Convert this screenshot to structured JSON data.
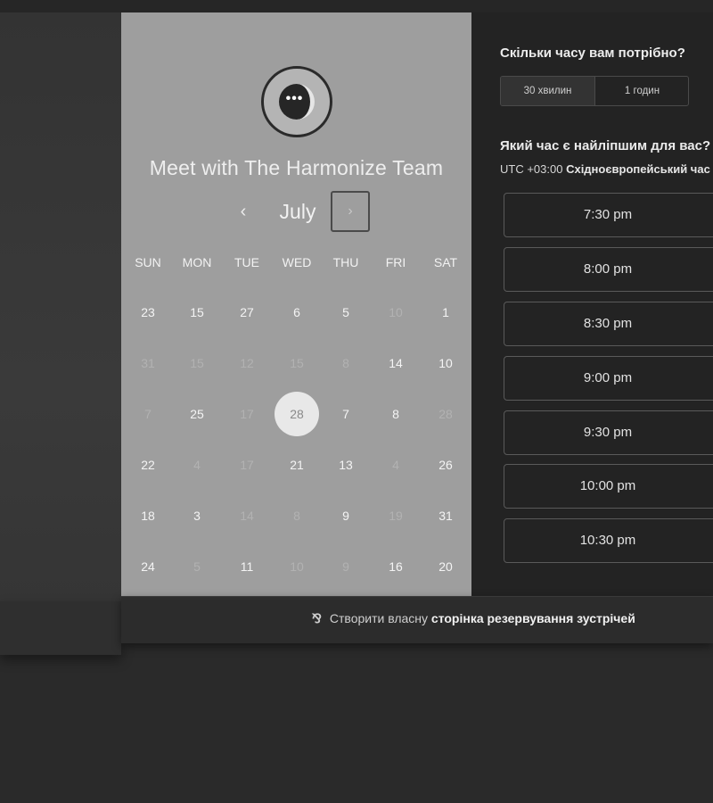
{
  "header": {
    "meet_title": "Meet with The Harmonize Team",
    "avatar_icon": "chat-bubble-icon",
    "avatar_dots": "•••"
  },
  "calendar": {
    "month": "July",
    "prev_label": "‹",
    "next_label": "›",
    "weekdays": [
      "SUN",
      "MON",
      "TUE",
      "WED",
      "THU",
      "FRI",
      "SAT"
    ],
    "weeks": [
      [
        {
          "d": "23",
          "dim": false
        },
        {
          "d": "15",
          "dim": false
        },
        {
          "d": "27",
          "dim": false
        },
        {
          "d": "6",
          "dim": false
        },
        {
          "d": "5",
          "dim": false
        },
        {
          "d": "10",
          "dim": true
        },
        {
          "d": "1",
          "dim": false
        }
      ],
      [
        {
          "d": "31",
          "dim": true
        },
        {
          "d": "15",
          "dim": true
        },
        {
          "d": "12",
          "dim": true
        },
        {
          "d": "15",
          "dim": true
        },
        {
          "d": "8",
          "dim": true
        },
        {
          "d": "14",
          "dim": false
        },
        {
          "d": "10",
          "dim": false
        }
      ],
      [
        {
          "d": "7",
          "dim": true
        },
        {
          "d": "25",
          "dim": false
        },
        {
          "d": "17",
          "dim": true
        },
        {
          "d": "28",
          "dim": false,
          "selected": true
        },
        {
          "d": "7",
          "dim": false
        },
        {
          "d": "8",
          "dim": false
        },
        {
          "d": "28",
          "dim": true
        }
      ],
      [
        {
          "d": "22",
          "dim": false
        },
        {
          "d": "4",
          "dim": true
        },
        {
          "d": "17",
          "dim": true
        },
        {
          "d": "21",
          "dim": false
        },
        {
          "d": "13",
          "dim": false
        },
        {
          "d": "4",
          "dim": true
        },
        {
          "d": "26",
          "dim": false
        }
      ],
      [
        {
          "d": "18",
          "dim": false
        },
        {
          "d": "3",
          "dim": false
        },
        {
          "d": "14",
          "dim": true
        },
        {
          "d": "8",
          "dim": true
        },
        {
          "d": "9",
          "dim": false
        },
        {
          "d": "19",
          "dim": true
        },
        {
          "d": "31",
          "dim": false
        }
      ],
      [
        {
          "d": "24",
          "dim": false
        },
        {
          "d": "5",
          "dim": true
        },
        {
          "d": "11",
          "dim": false
        },
        {
          "d": "10",
          "dim": true
        },
        {
          "d": "9",
          "dim": true
        },
        {
          "d": "16",
          "dim": false
        },
        {
          "d": "20",
          "dim": false
        }
      ]
    ]
  },
  "booking": {
    "duration_question": "Скільки часу вам потрібно?",
    "durations": [
      "30 хвилин",
      "1 годин"
    ],
    "time_question": "Який час є найліпшим для вас?",
    "timezone_offset": "UTC +03:00",
    "timezone_name": "Східноєвропейський час",
    "slots": [
      "7:30 pm",
      "8:00 pm",
      "8:30 pm",
      "9:00 pm",
      "9:30 pm",
      "10:00 pm",
      "10:30 pm"
    ]
  },
  "footer": {
    "logo_icon": "hubspot-sprocket-icon",
    "logo_glyph": "⅋",
    "text_prefix": "Створити власну",
    "text_bold": "сторінка резервування зустрічей"
  },
  "colors": {
    "left_panel": "#9e9e9e",
    "right_panel": "#232323",
    "selected_day": "#e8e8e8"
  }
}
